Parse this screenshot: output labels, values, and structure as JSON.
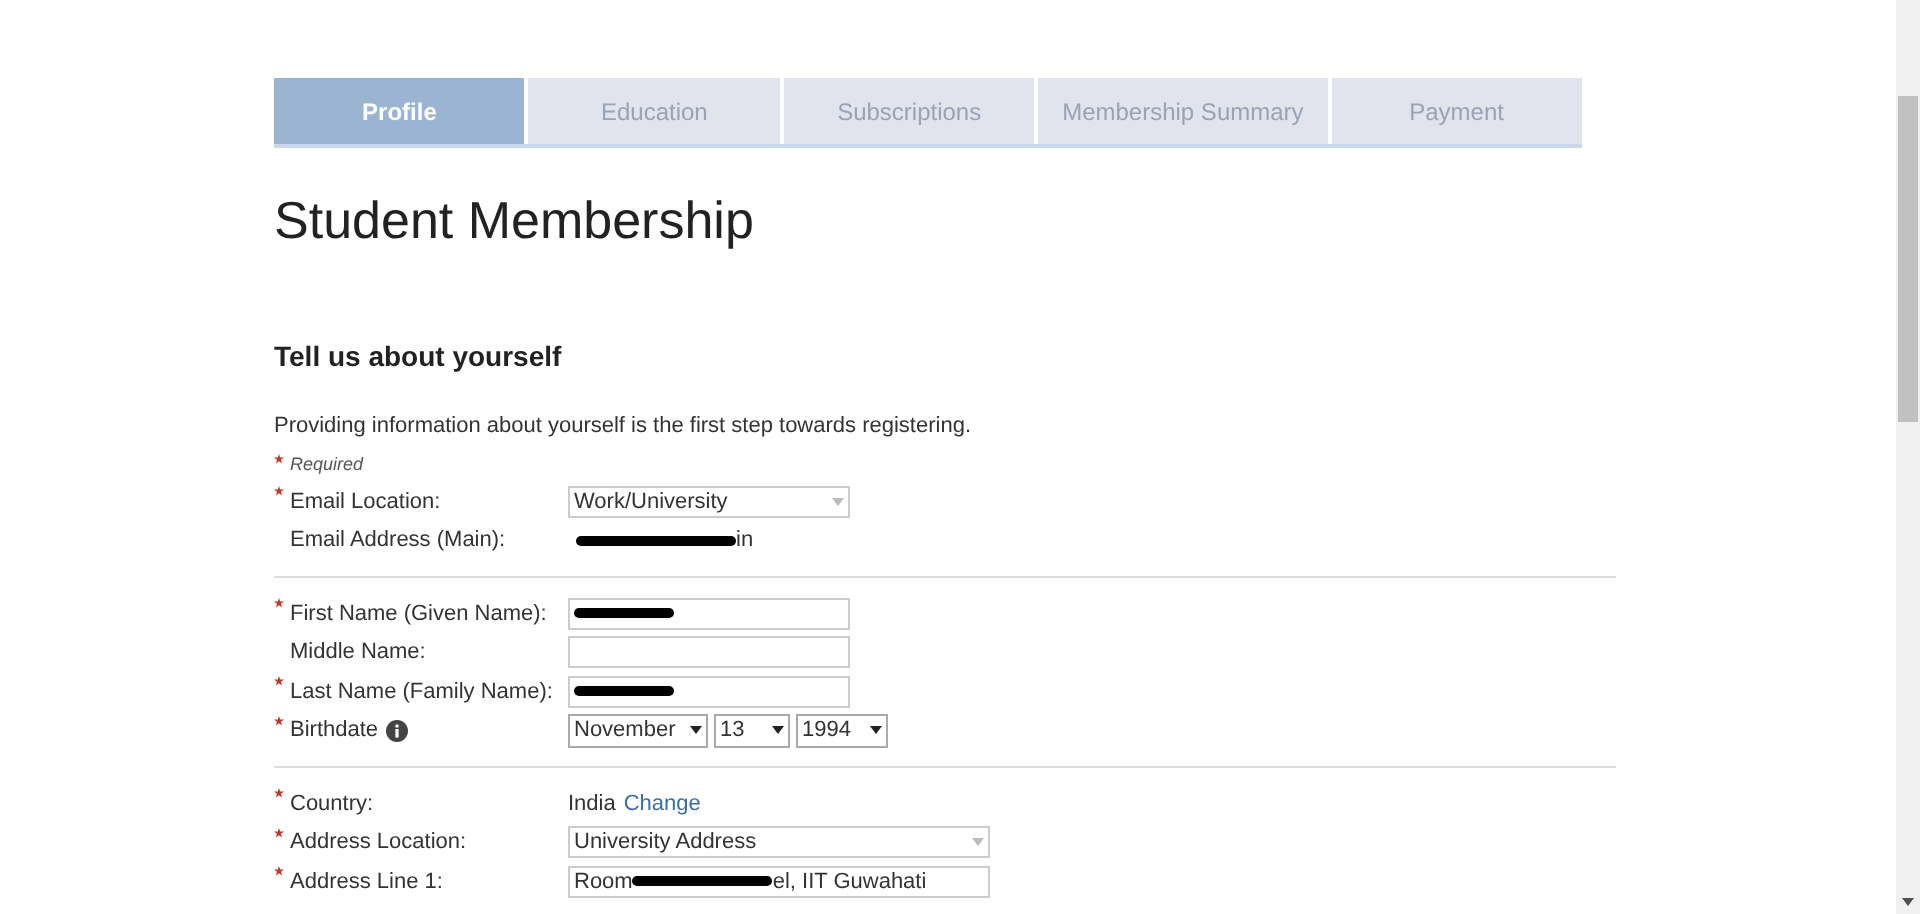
{
  "steps": [
    {
      "label": "Profile",
      "selected": true
    },
    {
      "label": "Education",
      "selected": false
    },
    {
      "label": "Subscriptions",
      "selected": false
    },
    {
      "label": "Membership Summary",
      "selected": false
    },
    {
      "label": "Payment",
      "selected": false
    }
  ],
  "title": "Student Membership",
  "section": {
    "heading": "Tell us about yourself",
    "intro": "Providing information about yourself is the first step towards registering.",
    "required_note": "Required"
  },
  "groups": [
    [
      {
        "kind": "select",
        "label": "Email Location:",
        "required": true,
        "value": "Work/University",
        "wide": false
      },
      {
        "kind": "text",
        "label": "Email Address (Main):",
        "required": false,
        "segments": [
          {
            "kind": "redaction"
          },
          {
            "kind": "text",
            "text": "in"
          }
        ]
      }
    ],
    [
      {
        "kind": "input",
        "label": "First Name (Given Name):",
        "required": true,
        "segments": [
          {
            "kind": "redaction"
          }
        ]
      },
      {
        "kind": "input",
        "label": "Middle Name:",
        "required": false
      },
      {
        "kind": "input",
        "label": "Last Name (Family Name):",
        "required": true,
        "segments": [
          {
            "kind": "redaction"
          }
        ]
      },
      {
        "kind": "date",
        "label": "Birthdate",
        "required": true,
        "info": true,
        "parts": [
          "November",
          "13",
          "1994"
        ]
      }
    ],
    [
      {
        "kind": "link",
        "label": "Country:",
        "required": true,
        "value": "India",
        "link": "Change"
      },
      {
        "kind": "select",
        "label": "Address Location:",
        "required": true,
        "value": "University Address",
        "wide": true
      },
      {
        "kind": "input",
        "label": "Address Line 1:",
        "required": true,
        "wide": true,
        "segments": [
          {
            "kind": "text",
            "text": "Room"
          },
          {
            "kind": "redaction"
          },
          {
            "kind": "text",
            "text": "el, IIT Guwahati"
          }
        ]
      }
    ]
  ]
}
